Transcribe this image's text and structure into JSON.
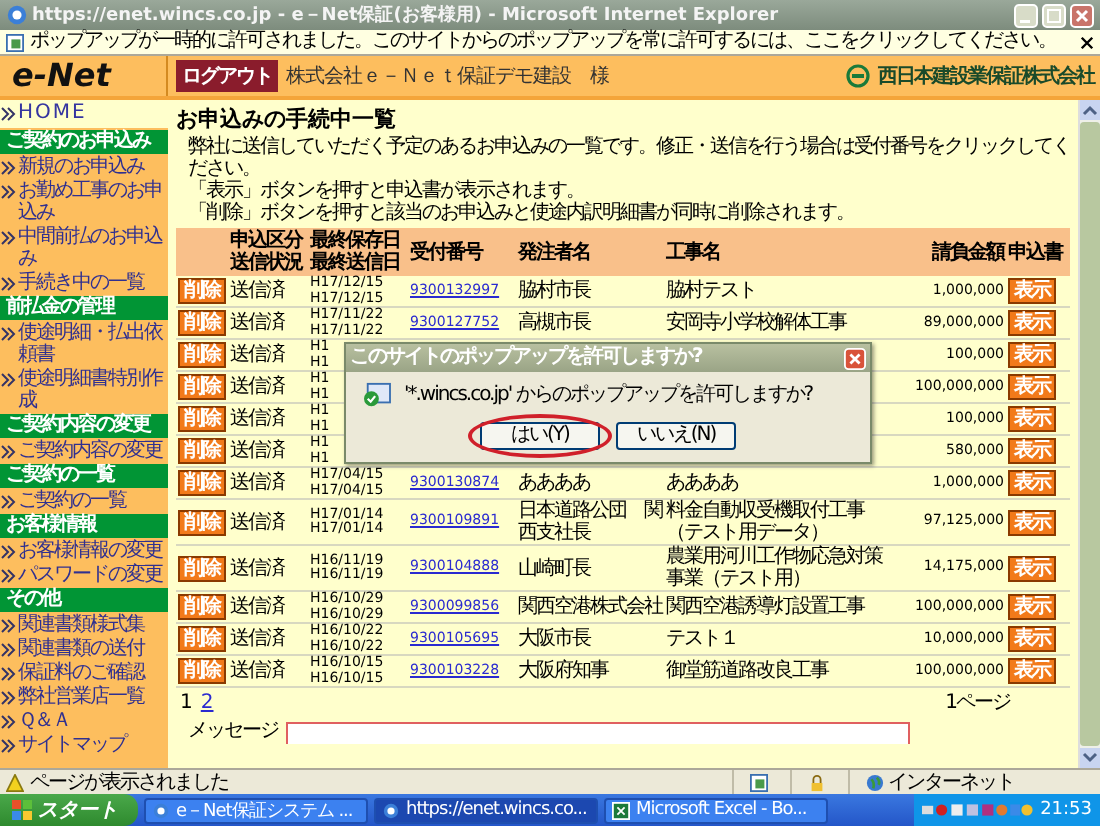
{
  "window": {
    "title": "https://enet.wincs.co.jp - e－Net保証(お客様用) - Microsoft Internet Explorer"
  },
  "info_bar": {
    "text": "ポップアップが一時的に許可されました。このサイトからのポップアップを常に許可するには、ここをクリックしてください。"
  },
  "header": {
    "logo": "e-Net",
    "logout": "ログアウト",
    "company": "株式会社ｅ－Ｎｅｔ保証デモ建設　様",
    "org": "西日本建設業保証株式会社"
  },
  "sidebar": {
    "home": "HOME",
    "sections": [
      {
        "title": "ご契約のお申込み",
        "items": [
          "新規のお申込み",
          "お勤め工事のお申込み",
          "中間前払のお申込み",
          "手続き中の一覧"
        ]
      },
      {
        "title": "前払金の管理",
        "items": [
          "使途明細・払出依頼書",
          "使途明細書特別作成"
        ]
      },
      {
        "title": "ご契約内容の変更",
        "items": [
          "ご契約内容の変更"
        ]
      },
      {
        "title": "ご契約の一覧",
        "items": [
          "ご契約の一覧"
        ]
      },
      {
        "title": "お客様情報",
        "items": [
          "お客様情報の変更",
          "パスワードの変更"
        ]
      },
      {
        "title": "その他",
        "items": [
          "関連書類様式集",
          "関連書類の送付",
          "保証料のご確認",
          "弊社営業店一覧",
          "Ｑ＆Ａ",
          "サイトマップ"
        ]
      }
    ]
  },
  "page": {
    "title": "お申込みの手続中一覧",
    "description": [
      "弊社に送信していただく予定のあるお申込みの一覧です。修正・送信を行う場合は受付番号をクリックしてください。",
      "「表示」ボタンを押すと申込書が表示されます。",
      "「削除」ボタンを押すと該当のお申込みと使途内訳明細書が同時に削除されます。"
    ]
  },
  "table": {
    "columns": [
      {
        "lines": [
          "申込区分",
          "送信状況"
        ]
      },
      {
        "lines": [
          "最終保存日",
          "最終送信日"
        ]
      },
      {
        "lines": [
          "受付番号"
        ]
      },
      {
        "lines": [
          "発注者名"
        ]
      },
      {
        "lines": [
          "工事名"
        ]
      },
      {
        "lines": [
          "請負金額"
        ]
      },
      {
        "lines": [
          "申込書"
        ]
      }
    ],
    "rows": [
      {
        "delete": "削除",
        "status": "送信済",
        "dates": [
          "H17/12/15",
          "H17/12/15"
        ],
        "number": "9300132997",
        "orderer": "脇村市長",
        "work": "脇村テスト",
        "amount": "1,000,000",
        "view": "表示"
      },
      {
        "delete": "削除",
        "status": "送信済",
        "dates": [
          "H17/11/22",
          "H17/11/22"
        ],
        "number": "9300127752",
        "orderer": "高槻市長",
        "work": "安岡寺小学校解体工事",
        "amount": "89,000,000",
        "view": "表示"
      },
      {
        "delete": "削除",
        "status": "送信済",
        "dates": [
          "H1",
          "H1"
        ],
        "amount": "100,000",
        "view": "表示"
      },
      {
        "delete": "削除",
        "status": "送信済",
        "dates": [
          "H1",
          "H1"
        ],
        "amount": "100,000,000",
        "view": "表示"
      },
      {
        "delete": "削除",
        "status": "送信済",
        "dates": [
          "H1",
          "H1"
        ],
        "amount": "100,000",
        "view": "表示"
      },
      {
        "delete": "削除",
        "status": "送信済",
        "dates": [
          "H1",
          "H1"
        ],
        "amount": "580,000",
        "view": "表示"
      },
      {
        "delete": "削除",
        "status": "送信済",
        "dates": [
          "H17/04/15",
          "H17/04/15"
        ],
        "number": "9300130874",
        "orderer": "ああああ",
        "work": "ああああ",
        "amount": "1,000,000",
        "view": "表示"
      },
      {
        "delete": "削除",
        "status": "送信済",
        "dates": [
          "H17/01/14",
          "H17/01/14"
        ],
        "number": "9300109891",
        "orderer": "日本道路公団　関西支社長",
        "work": "料金自動収受機取付工事（テスト用データ）",
        "amount": "97,125,000",
        "view": "表示"
      },
      {
        "delete": "削除",
        "status": "送信済",
        "dates": [
          "H16/11/19",
          "H16/11/19"
        ],
        "number": "9300104888",
        "orderer": "山崎町長",
        "work": "農業用河川工作物応急対策事業（テスト用）",
        "amount": "14,175,000",
        "view": "表示"
      },
      {
        "delete": "削除",
        "status": "送信済",
        "dates": [
          "H16/10/29",
          "H16/10/29"
        ],
        "number": "9300099856",
        "orderer": "関西空港株式会社",
        "work": "関西空港誘導灯設置工事",
        "amount": "100,000,000",
        "view": "表示"
      },
      {
        "delete": "削除",
        "status": "送信済",
        "dates": [
          "H16/10/22",
          "H16/10/22"
        ],
        "number": "9300105695",
        "orderer": "大阪市長",
        "work": "テスト１",
        "amount": "10,000,000",
        "view": "表示"
      },
      {
        "delete": "削除",
        "status": "送信済",
        "dates": [
          "H16/10/15",
          "H16/10/15"
        ],
        "number": "9300103228",
        "orderer": "大阪府知事",
        "work": "御堂筋道路改良工事",
        "amount": "100,000,000",
        "view": "表示"
      }
    ]
  },
  "pagination": {
    "pages": [
      {
        "label": "1",
        "selected": true
      },
      {
        "label": "2",
        "selected": false
      }
    ],
    "count": "1ページ"
  },
  "message": {
    "label": "メッセージ"
  },
  "dialog": {
    "title": "このサイトのポップアップを許可しますか?",
    "message": "'*.wincs.co.jp' からのポップアップを許可しますか?",
    "buttons": [
      {
        "label": "はい(Y)",
        "highlighted": true
      },
      {
        "label": "いいえ(N)",
        "highlighted": false
      }
    ]
  },
  "status_bar": {
    "text": "ページが表示されました",
    "zone": "インターネット"
  },
  "taskbar": {
    "start": "スタート",
    "tasks": [
      {
        "label": "e－Net保証システム ...",
        "kind": "ie",
        "selected": false
      },
      {
        "label": "https://enet.wincs.co...",
        "kind": "ie",
        "selected": true
      },
      {
        "label": "Microsoft Excel - Bo...",
        "kind": "excel",
        "selected": false
      }
    ],
    "clock": "21:53"
  }
}
